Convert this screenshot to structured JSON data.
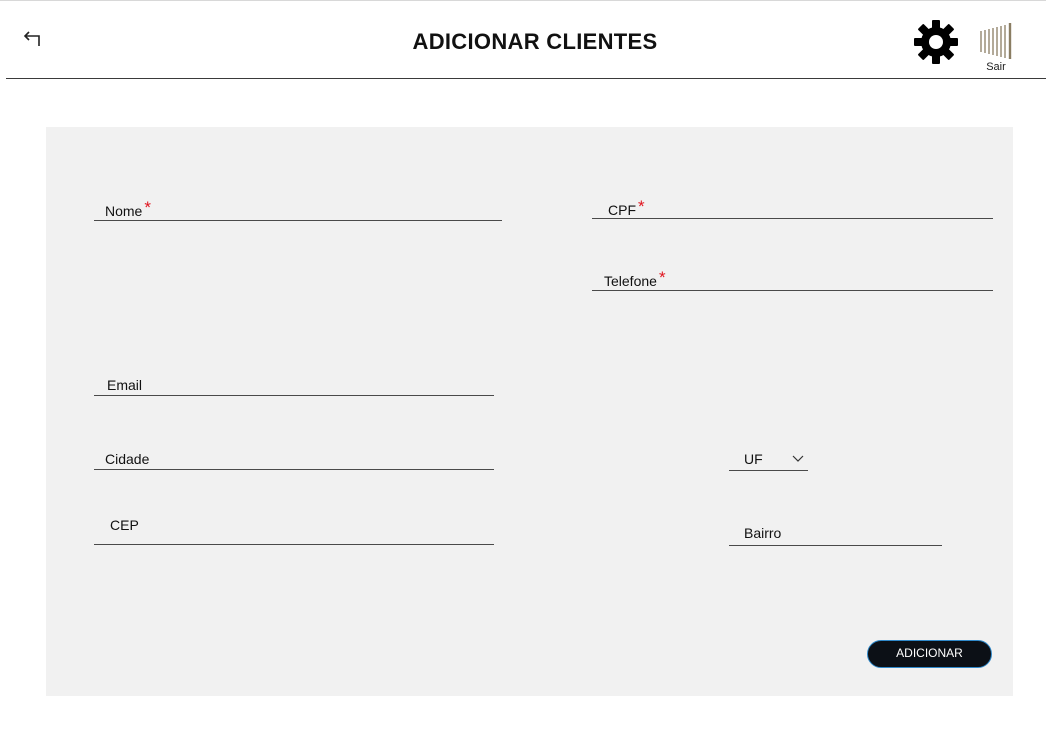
{
  "header": {
    "title": "ADICIONAR CLIENTES",
    "back_icon": "back-arrow-icon",
    "settings_icon": "gear-icon",
    "logout_icon": "door-bars-icon",
    "logout_label": "Sair"
  },
  "form": {
    "fields": {
      "nome": {
        "label": "Nome",
        "required": "*"
      },
      "cpf": {
        "label": "CPF",
        "required": "*"
      },
      "telefone": {
        "label": "Telefone",
        "required": "*"
      },
      "email": {
        "label": "Email"
      },
      "cidade": {
        "label": "Cidade"
      },
      "uf": {
        "label": "UF",
        "icon": "chevron-down-icon"
      },
      "cep": {
        "label": "CEP"
      },
      "bairro": {
        "label": "Bairro"
      }
    },
    "submit_label": "ADICIONAR"
  },
  "colors": {
    "panel_bg": "#f1f1f1",
    "required_star": "#e0141e",
    "button_bg": "#0c1016",
    "button_border": "#2f88c9",
    "logout_bars": "#8a7d62"
  }
}
